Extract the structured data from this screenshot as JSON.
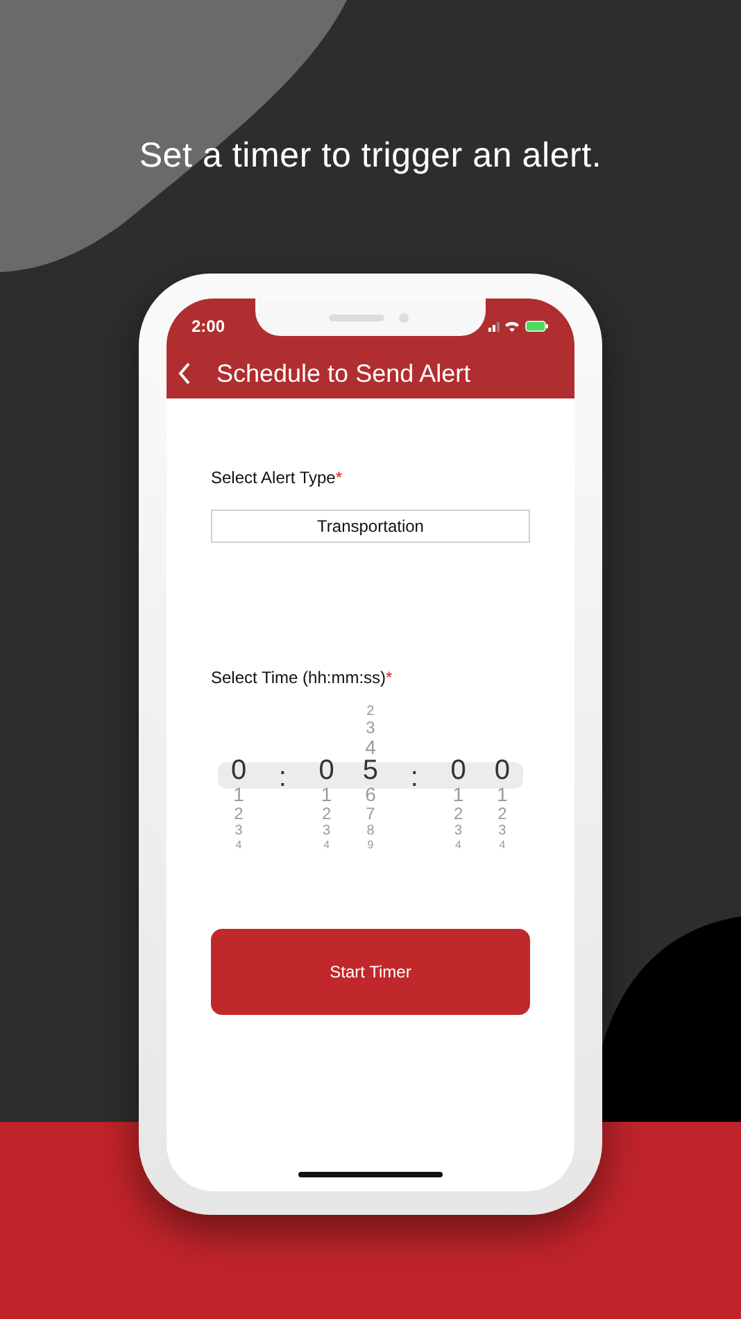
{
  "headline": "Set a timer to trigger an alert.",
  "status_bar": {
    "time": "2:00"
  },
  "nav": {
    "title": "Schedule to Send Alert"
  },
  "alert_type": {
    "label": "Select Alert Type",
    "required": "*",
    "value": "Transportation"
  },
  "time": {
    "label": "Select Time (hh:mm:ss)",
    "required": "*"
  },
  "picker": [
    {
      "kind": "digits",
      "selected": "0",
      "below": [
        "1",
        "2",
        "3",
        "4"
      ]
    },
    {
      "kind": "separator",
      "text": ":"
    },
    {
      "kind": "digits",
      "selected": "0",
      "below": [
        "1",
        "2",
        "3",
        "4"
      ]
    },
    {
      "kind": "digits",
      "above": [
        "2",
        "3",
        "4"
      ],
      "selected": "5",
      "below": [
        "6",
        "7",
        "8",
        "9"
      ]
    },
    {
      "kind": "separator",
      "text": ":"
    },
    {
      "kind": "digits",
      "selected": "0",
      "below": [
        "1",
        "2",
        "3",
        "4"
      ]
    },
    {
      "kind": "digits",
      "selected": "0",
      "below": [
        "1",
        "2",
        "3",
        "4"
      ]
    }
  ],
  "button": "Start Timer"
}
